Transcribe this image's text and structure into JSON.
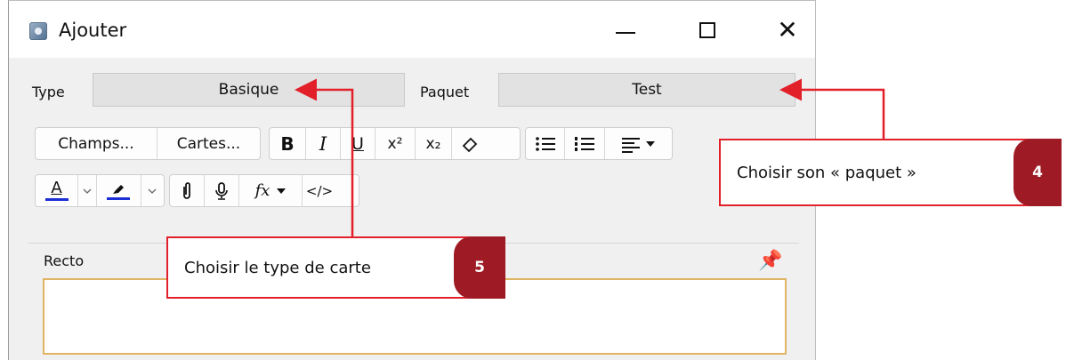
{
  "window": {
    "title": "Ajouter",
    "icon": "app-icon"
  },
  "controls": {
    "minimize_icon": "minimize-icon",
    "maximize_icon": "maximize-icon",
    "close_icon": "close-icon"
  },
  "form": {
    "type_label": "Type",
    "type_value": "Basique",
    "deck_label": "Paquet",
    "deck_value": "Test"
  },
  "toolbar": {
    "fields_button": "Champs...",
    "cards_button": "Cartes...",
    "bold": "B",
    "italic": "I",
    "underline": "U",
    "superscript": "x²",
    "subscript": "x₂",
    "math": "fx"
  },
  "field": {
    "label": "Recto",
    "value": ""
  },
  "callouts": [
    {
      "text": "Choisir son « paquet »",
      "number": "4"
    },
    {
      "text": "Choisir le type de carte",
      "number": "5"
    }
  ],
  "colors": {
    "annotation_red": "#e2202a",
    "badge": "#9e1b25",
    "field_border": "#e0b463",
    "text_color_bar": "#1a2fd6"
  }
}
